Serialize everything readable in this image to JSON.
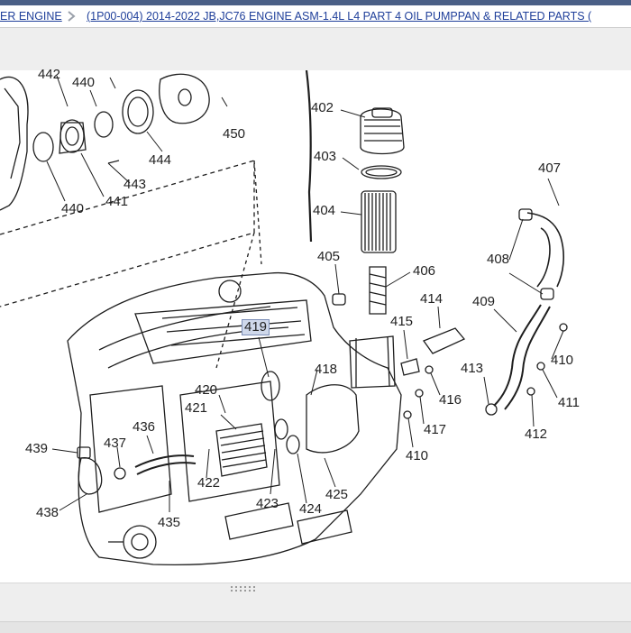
{
  "breadcrumb": {
    "crumb1": "ER ENGINE",
    "crumb2": "(1P00-004)   2014-2022   JB,JC76   ENGINE ASM-1.4L L4 PART 4 OIL PUMPPAN & RELATED PARTS ("
  },
  "diagram": {
    "selected_callout": "419",
    "callouts": {
      "c442": "442",
      "c440a": "440",
      "c450": "450",
      "c444": "444",
      "c443": "443",
      "c441": "441",
      "c440b": "440",
      "c402": "402",
      "c403": "403",
      "c404": "404",
      "c405": "405",
      "c406": "406",
      "c407": "407",
      "c408": "408",
      "c409": "409",
      "c410a": "410",
      "c411": "411",
      "c412": "412",
      "c413": "413",
      "c414": "414",
      "c415": "415",
      "c416": "416",
      "c417": "417",
      "c410b": "410",
      "c418": "418",
      "c419": "419",
      "c420": "420",
      "c421": "421",
      "c422": "422",
      "c423": "423",
      "c424": "424",
      "c425": "425",
      "c436": "436",
      "c437": "437",
      "c439": "439",
      "c438": "438",
      "c435": "435"
    }
  },
  "colors": {
    "header_bar": "#4a5f86",
    "link": "#1f3f9a",
    "selected_callout_bg": "#cfd8ea"
  }
}
